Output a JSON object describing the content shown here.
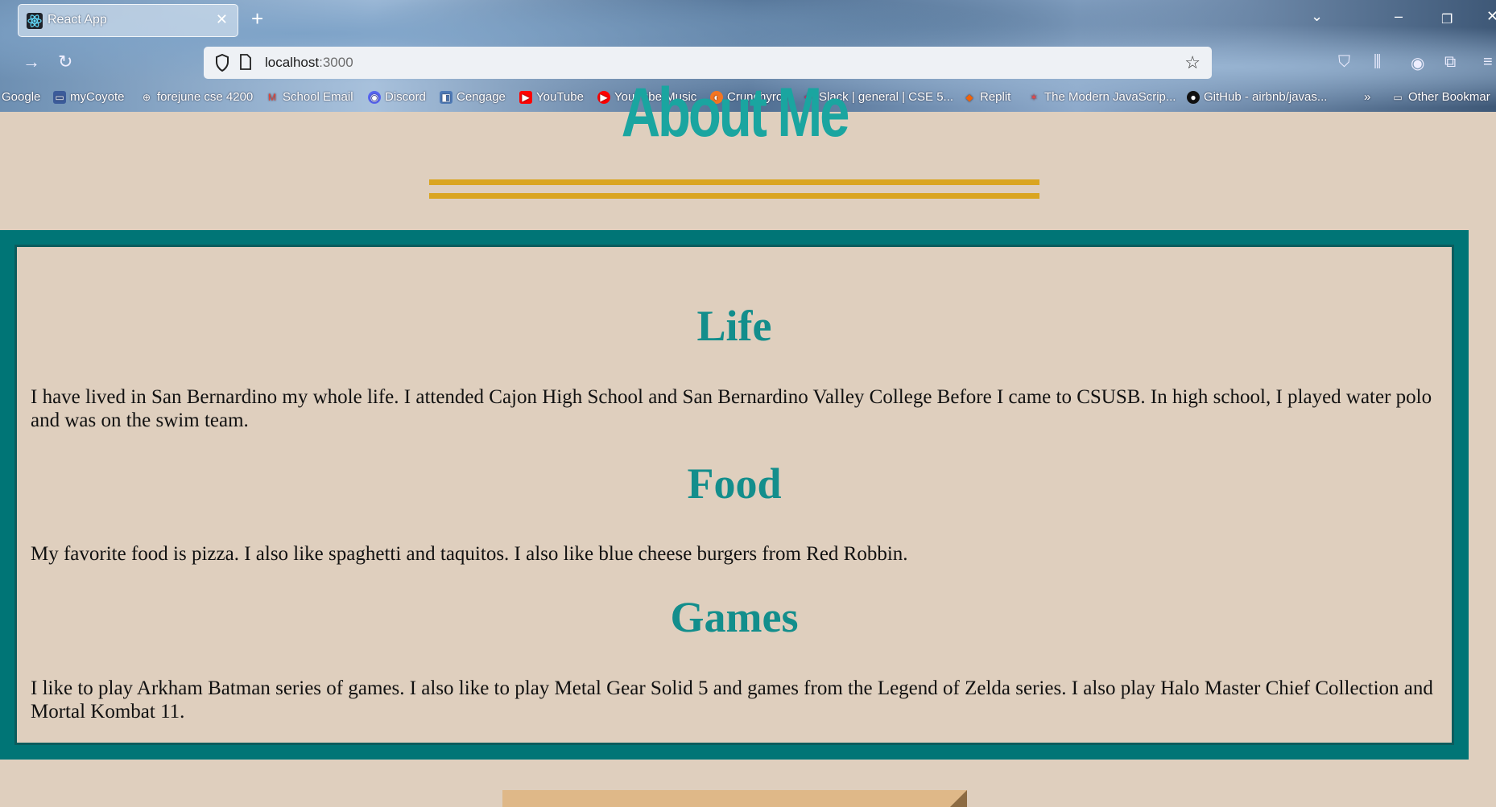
{
  "browser": {
    "tab_title": "React App",
    "url_host": "localhost",
    "url_port": ":3000",
    "bookmarks": [
      {
        "label": "Google",
        "icon": "google-icon"
      },
      {
        "label": "myCoyote",
        "icon": "coyote-icon"
      },
      {
        "label": "forejune cse 4200",
        "icon": "globe-icon"
      },
      {
        "label": "School Email",
        "icon": "gmail-icon"
      },
      {
        "label": "Discord",
        "icon": "discord-icon"
      },
      {
        "label": "Cengage",
        "icon": "cengage-icon"
      },
      {
        "label": "YouTube",
        "icon": "youtube-icon"
      },
      {
        "label": "YouTube Music",
        "icon": "youtube-music-icon"
      },
      {
        "label": "Crunchyroll",
        "icon": "crunchyroll-icon"
      },
      {
        "label": "Slack | general | CSE 5...",
        "icon": "slack-icon"
      },
      {
        "label": "Replit",
        "icon": "replit-icon"
      },
      {
        "label": "The Modern JavaScrip...",
        "icon": "javascript-info-icon"
      },
      {
        "label": "GitHub - airbnb/javas...",
        "icon": "github-icon"
      }
    ],
    "other_bookmarks": "Other Bookmar"
  },
  "page": {
    "title": "About Me",
    "sections": [
      {
        "heading": "Life",
        "text": "I have lived in San Bernardino my whole life. I attended Cajon High School and San Bernardino Valley College Before I came to CSUSB. In high school, I played water polo and was on the swim team."
      },
      {
        "heading": "Food",
        "text": "My favorite food is pizza. I also like spaghetti and taquitos. I also like blue cheese burgers from Red Robbin."
      },
      {
        "heading": "Games",
        "text": "I like to play Arkham Batman series of games. I also like to play Metal Gear Solid 5 and games from the Legend of Zelda series. I also play Halo Master Chief Collection and Mortal Kombat 11."
      }
    ]
  },
  "colors": {
    "background": "#dfcfbe",
    "title": "#1aa5a0",
    "rule": "#daa520",
    "border": "#007576",
    "heading": "#138e8c"
  }
}
